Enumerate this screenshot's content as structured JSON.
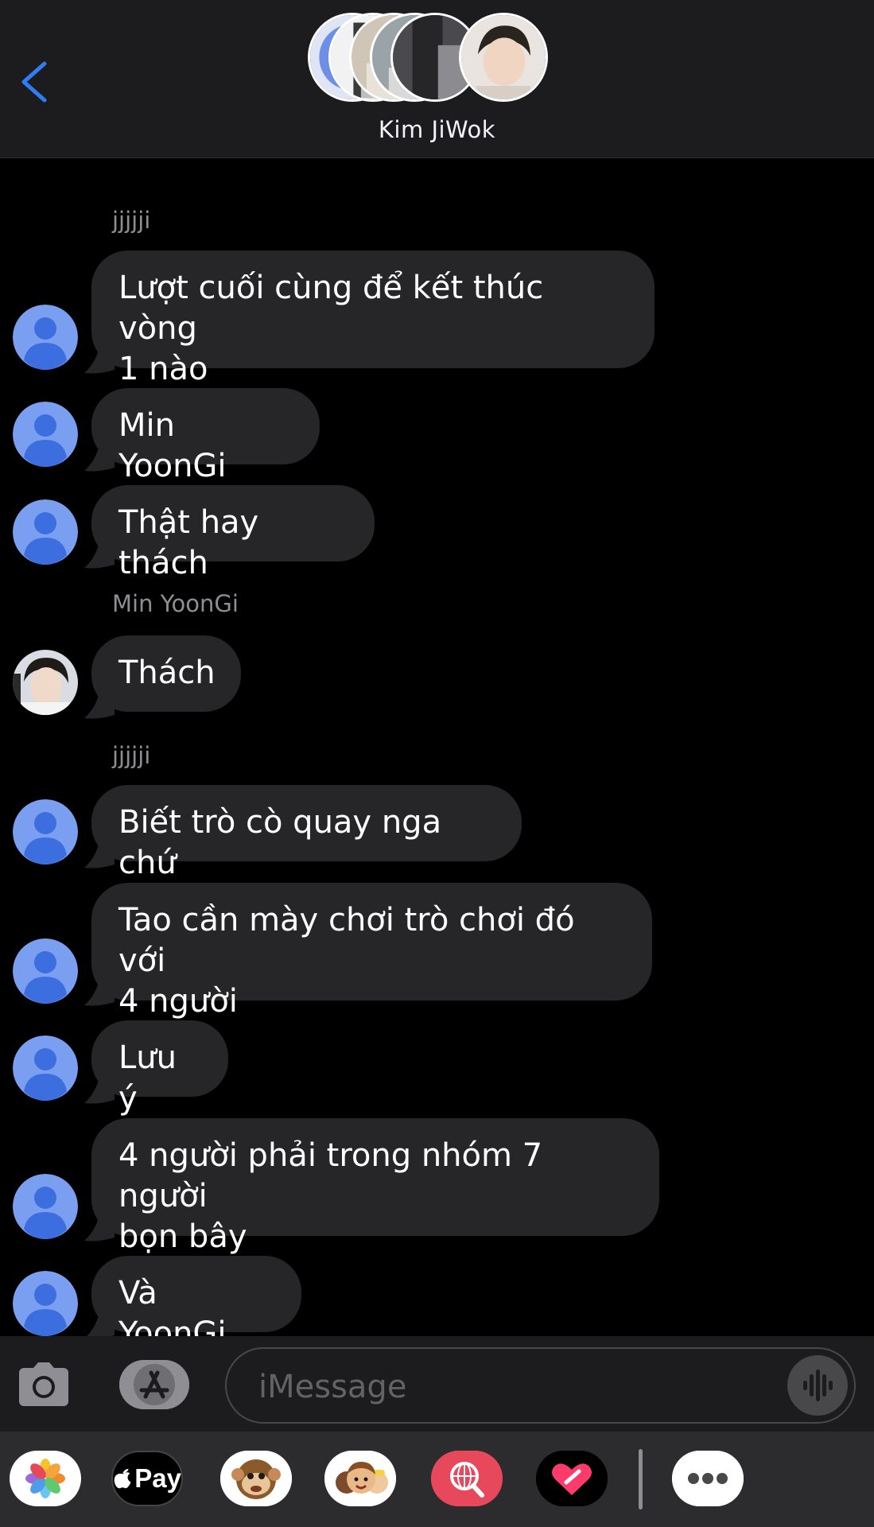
{
  "header": {
    "contact_name": "Kim JiWok",
    "back_icon": "chevron-left-icon",
    "accent_color": "#2f7cf6"
  },
  "messages": [
    {
      "sender": "jjjjji",
      "text_lines": [
        "Lượt cuối cùng để kết thúc vòng",
        "1 nào"
      ],
      "avatar": "default-person"
    },
    {
      "text_lines": [
        "Min YoonGi"
      ],
      "avatar": "default-person"
    },
    {
      "text_lines": [
        "Thật hay thách"
      ],
      "avatar": "default-person"
    },
    {
      "sender": "Min YoonGi",
      "text_lines": [
        "Thách"
      ],
      "avatar": "photo"
    },
    {
      "sender": "jjjjji",
      "text_lines": [
        "Biết trò cò quay nga chứ"
      ],
      "avatar": "default-person"
    },
    {
      "text_lines": [
        "Tao cần mày chơi trò chơi đó với",
        "4 người"
      ],
      "avatar": "default-person"
    },
    {
      "text_lines": [
        "Lưu ý"
      ],
      "avatar": "default-person"
    },
    {
      "text_lines": [
        "4 người phải trong nhóm 7 người",
        "bọn bây"
      ],
      "avatar": "default-person"
    },
    {
      "text_lines": [
        "Và YoonGi"
      ],
      "avatar": "default-person"
    }
  ],
  "input_bar": {
    "placeholder": "iMessage",
    "camera_icon": "camera-icon",
    "appstore_icon": "app-store-icon",
    "audio_icon": "audio-waveform-icon"
  },
  "app_drawer": {
    "apps": [
      "photos-icon",
      "apple-pay-icon",
      "animoji-monkey-icon",
      "memoji-icon",
      "web-search-icon",
      "digital-touch-icon",
      "more-apps-icon"
    ],
    "pay_label": "Pay"
  },
  "colors": {
    "bubble": "#262628",
    "avatar_default": "#7b9ff0",
    "sender_label": "#8e8e93"
  }
}
